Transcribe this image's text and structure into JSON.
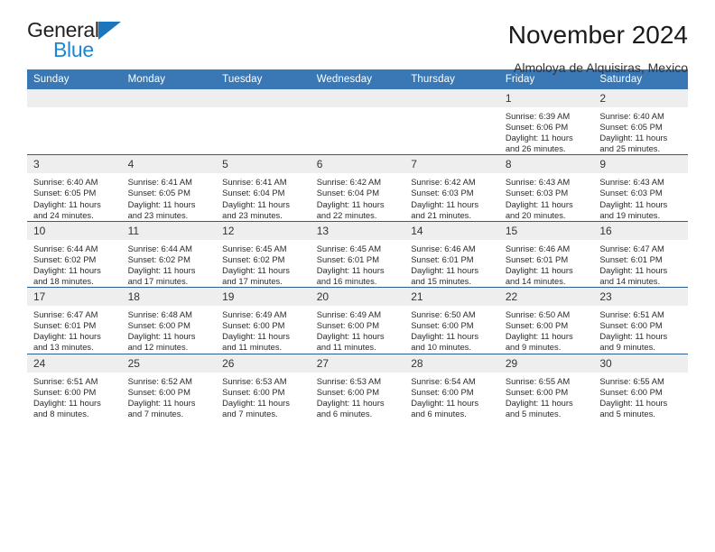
{
  "brand": {
    "name_part1": "General",
    "name_part2": "Blue",
    "triangle_color": "#1d76bb",
    "blue_text_color": "#1d87d4",
    "dark_text_color": "#231f20"
  },
  "header": {
    "title": "November 2024",
    "subtitle": "Almoloya de Alquisiras, Mexico"
  },
  "theme": {
    "header_row_bg": "#3978b5",
    "header_row_text": "#ffffff",
    "daynum_bg": "#eeeeee",
    "cell_border": "#2b5f93"
  },
  "weekdays": [
    "Sunday",
    "Monday",
    "Tuesday",
    "Wednesday",
    "Thursday",
    "Friday",
    "Saturday"
  ],
  "weeks": [
    [
      {
        "day": "",
        "sunrise": "",
        "sunset": "",
        "daylight_line1": "",
        "daylight_line2": "",
        "empty": true
      },
      {
        "day": "",
        "sunrise": "",
        "sunset": "",
        "daylight_line1": "",
        "daylight_line2": "",
        "empty": true
      },
      {
        "day": "",
        "sunrise": "",
        "sunset": "",
        "daylight_line1": "",
        "daylight_line2": "",
        "empty": true
      },
      {
        "day": "",
        "sunrise": "",
        "sunset": "",
        "daylight_line1": "",
        "daylight_line2": "",
        "empty": true
      },
      {
        "day": "",
        "sunrise": "",
        "sunset": "",
        "daylight_line1": "",
        "daylight_line2": "",
        "empty": true
      },
      {
        "day": "1",
        "sunrise": "Sunrise: 6:39 AM",
        "sunset": "Sunset: 6:06 PM",
        "daylight_line1": "Daylight: 11 hours",
        "daylight_line2": "and 26 minutes.",
        "empty": false
      },
      {
        "day": "2",
        "sunrise": "Sunrise: 6:40 AM",
        "sunset": "Sunset: 6:05 PM",
        "daylight_line1": "Daylight: 11 hours",
        "daylight_line2": "and 25 minutes.",
        "empty": false
      }
    ],
    [
      {
        "day": "3",
        "sunrise": "Sunrise: 6:40 AM",
        "sunset": "Sunset: 6:05 PM",
        "daylight_line1": "Daylight: 11 hours",
        "daylight_line2": "and 24 minutes.",
        "empty": false
      },
      {
        "day": "4",
        "sunrise": "Sunrise: 6:41 AM",
        "sunset": "Sunset: 6:05 PM",
        "daylight_line1": "Daylight: 11 hours",
        "daylight_line2": "and 23 minutes.",
        "empty": false
      },
      {
        "day": "5",
        "sunrise": "Sunrise: 6:41 AM",
        "sunset": "Sunset: 6:04 PM",
        "daylight_line1": "Daylight: 11 hours",
        "daylight_line2": "and 23 minutes.",
        "empty": false
      },
      {
        "day": "6",
        "sunrise": "Sunrise: 6:42 AM",
        "sunset": "Sunset: 6:04 PM",
        "daylight_line1": "Daylight: 11 hours",
        "daylight_line2": "and 22 minutes.",
        "empty": false
      },
      {
        "day": "7",
        "sunrise": "Sunrise: 6:42 AM",
        "sunset": "Sunset: 6:03 PM",
        "daylight_line1": "Daylight: 11 hours",
        "daylight_line2": "and 21 minutes.",
        "empty": false
      },
      {
        "day": "8",
        "sunrise": "Sunrise: 6:43 AM",
        "sunset": "Sunset: 6:03 PM",
        "daylight_line1": "Daylight: 11 hours",
        "daylight_line2": "and 20 minutes.",
        "empty": false
      },
      {
        "day": "9",
        "sunrise": "Sunrise: 6:43 AM",
        "sunset": "Sunset: 6:03 PM",
        "daylight_line1": "Daylight: 11 hours",
        "daylight_line2": "and 19 minutes.",
        "empty": false
      }
    ],
    [
      {
        "day": "10",
        "sunrise": "Sunrise: 6:44 AM",
        "sunset": "Sunset: 6:02 PM",
        "daylight_line1": "Daylight: 11 hours",
        "daylight_line2": "and 18 minutes.",
        "empty": false
      },
      {
        "day": "11",
        "sunrise": "Sunrise: 6:44 AM",
        "sunset": "Sunset: 6:02 PM",
        "daylight_line1": "Daylight: 11 hours",
        "daylight_line2": "and 17 minutes.",
        "empty": false
      },
      {
        "day": "12",
        "sunrise": "Sunrise: 6:45 AM",
        "sunset": "Sunset: 6:02 PM",
        "daylight_line1": "Daylight: 11 hours",
        "daylight_line2": "and 17 minutes.",
        "empty": false
      },
      {
        "day": "13",
        "sunrise": "Sunrise: 6:45 AM",
        "sunset": "Sunset: 6:01 PM",
        "daylight_line1": "Daylight: 11 hours",
        "daylight_line2": "and 16 minutes.",
        "empty": false
      },
      {
        "day": "14",
        "sunrise": "Sunrise: 6:46 AM",
        "sunset": "Sunset: 6:01 PM",
        "daylight_line1": "Daylight: 11 hours",
        "daylight_line2": "and 15 minutes.",
        "empty": false
      },
      {
        "day": "15",
        "sunrise": "Sunrise: 6:46 AM",
        "sunset": "Sunset: 6:01 PM",
        "daylight_line1": "Daylight: 11 hours",
        "daylight_line2": "and 14 minutes.",
        "empty": false
      },
      {
        "day": "16",
        "sunrise": "Sunrise: 6:47 AM",
        "sunset": "Sunset: 6:01 PM",
        "daylight_line1": "Daylight: 11 hours",
        "daylight_line2": "and 14 minutes.",
        "empty": false
      }
    ],
    [
      {
        "day": "17",
        "sunrise": "Sunrise: 6:47 AM",
        "sunset": "Sunset: 6:01 PM",
        "daylight_line1": "Daylight: 11 hours",
        "daylight_line2": "and 13 minutes.",
        "empty": false
      },
      {
        "day": "18",
        "sunrise": "Sunrise: 6:48 AM",
        "sunset": "Sunset: 6:00 PM",
        "daylight_line1": "Daylight: 11 hours",
        "daylight_line2": "and 12 minutes.",
        "empty": false
      },
      {
        "day": "19",
        "sunrise": "Sunrise: 6:49 AM",
        "sunset": "Sunset: 6:00 PM",
        "daylight_line1": "Daylight: 11 hours",
        "daylight_line2": "and 11 minutes.",
        "empty": false
      },
      {
        "day": "20",
        "sunrise": "Sunrise: 6:49 AM",
        "sunset": "Sunset: 6:00 PM",
        "daylight_line1": "Daylight: 11 hours",
        "daylight_line2": "and 11 minutes.",
        "empty": false
      },
      {
        "day": "21",
        "sunrise": "Sunrise: 6:50 AM",
        "sunset": "Sunset: 6:00 PM",
        "daylight_line1": "Daylight: 11 hours",
        "daylight_line2": "and 10 minutes.",
        "empty": false
      },
      {
        "day": "22",
        "sunrise": "Sunrise: 6:50 AM",
        "sunset": "Sunset: 6:00 PM",
        "daylight_line1": "Daylight: 11 hours",
        "daylight_line2": "and 9 minutes.",
        "empty": false
      },
      {
        "day": "23",
        "sunrise": "Sunrise: 6:51 AM",
        "sunset": "Sunset: 6:00 PM",
        "daylight_line1": "Daylight: 11 hours",
        "daylight_line2": "and 9 minutes.",
        "empty": false
      }
    ],
    [
      {
        "day": "24",
        "sunrise": "Sunrise: 6:51 AM",
        "sunset": "Sunset: 6:00 PM",
        "daylight_line1": "Daylight: 11 hours",
        "daylight_line2": "and 8 minutes.",
        "empty": false
      },
      {
        "day": "25",
        "sunrise": "Sunrise: 6:52 AM",
        "sunset": "Sunset: 6:00 PM",
        "daylight_line1": "Daylight: 11 hours",
        "daylight_line2": "and 7 minutes.",
        "empty": false
      },
      {
        "day": "26",
        "sunrise": "Sunrise: 6:53 AM",
        "sunset": "Sunset: 6:00 PM",
        "daylight_line1": "Daylight: 11 hours",
        "daylight_line2": "and 7 minutes.",
        "empty": false
      },
      {
        "day": "27",
        "sunrise": "Sunrise: 6:53 AM",
        "sunset": "Sunset: 6:00 PM",
        "daylight_line1": "Daylight: 11 hours",
        "daylight_line2": "and 6 minutes.",
        "empty": false
      },
      {
        "day": "28",
        "sunrise": "Sunrise: 6:54 AM",
        "sunset": "Sunset: 6:00 PM",
        "daylight_line1": "Daylight: 11 hours",
        "daylight_line2": "and 6 minutes.",
        "empty": false
      },
      {
        "day": "29",
        "sunrise": "Sunrise: 6:55 AM",
        "sunset": "Sunset: 6:00 PM",
        "daylight_line1": "Daylight: 11 hours",
        "daylight_line2": "and 5 minutes.",
        "empty": false
      },
      {
        "day": "30",
        "sunrise": "Sunrise: 6:55 AM",
        "sunset": "Sunset: 6:00 PM",
        "daylight_line1": "Daylight: 11 hours",
        "daylight_line2": "and 5 minutes.",
        "empty": false
      }
    ]
  ]
}
